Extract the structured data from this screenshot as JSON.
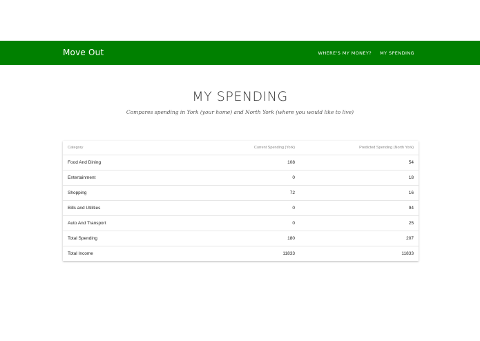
{
  "nav": {
    "brand": "Move Out",
    "links": [
      "WHERE'S MY MONEY?",
      "MY SPENDING"
    ]
  },
  "page": {
    "title": "MY SPENDING",
    "subtitle": "Compares spending in York (your home) and North York (where you would like to live)"
  },
  "table": {
    "headers": [
      "Category",
      "Current Spending (York)",
      "Predicted Spending (North York)"
    ],
    "rows": [
      [
        "Food And Dining",
        "108",
        "54"
      ],
      [
        "Entertainment",
        "0",
        "18"
      ],
      [
        "Shopping",
        "72",
        "16"
      ],
      [
        "Bills and Utilities",
        "0",
        "94"
      ],
      [
        "Auto And Transport",
        "0",
        "25"
      ],
      [
        "Total Spending",
        "180",
        "207"
      ],
      [
        "Total Income",
        "11833",
        "11833"
      ]
    ]
  },
  "colors": {
    "navbar": "#008000",
    "nav_text": "#ffffff",
    "background": "#ffffff"
  }
}
